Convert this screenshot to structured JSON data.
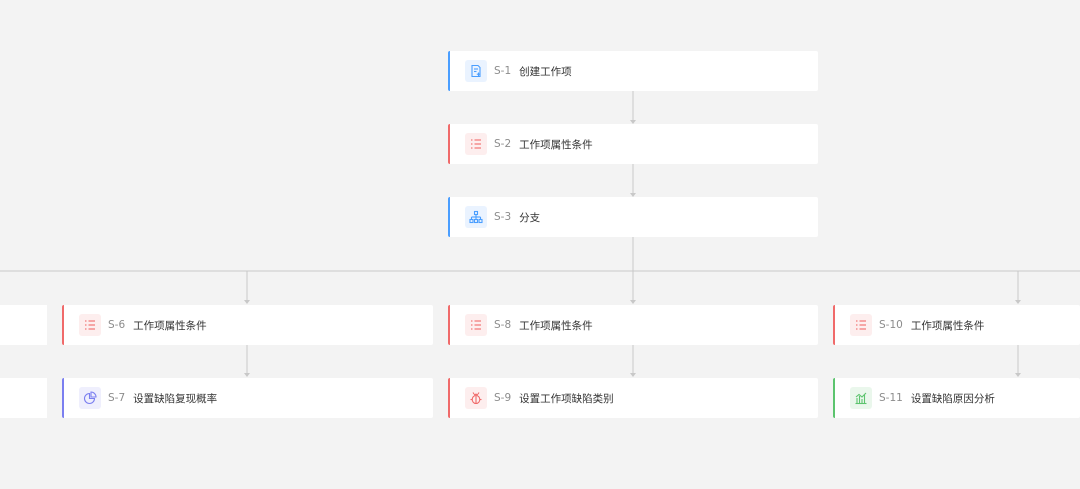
{
  "colors": {
    "blue": "#4a9eff",
    "red": "#f06a6a",
    "purple": "#7b7ff0",
    "green": "#5cc46e",
    "connector": "#c8c8c8"
  },
  "nodes": [
    {
      "id": "S-1",
      "code": "S-1",
      "label": "创建工作项",
      "icon": "document-add-icon",
      "color": "blue"
    },
    {
      "id": "S-2",
      "code": "S-2",
      "label": "工作项属性条件",
      "icon": "list-icon",
      "color": "red"
    },
    {
      "id": "S-3",
      "code": "S-3",
      "label": "分支",
      "icon": "hierarchy-icon",
      "color": "blue"
    },
    {
      "id": "S-6",
      "code": "S-6",
      "label": "工作项属性条件",
      "icon": "list-icon",
      "color": "red"
    },
    {
      "id": "S-7",
      "code": "S-7",
      "label": "设置缺陷复现概率",
      "icon": "pie-chart-icon",
      "color": "purple"
    },
    {
      "id": "S-8",
      "code": "S-8",
      "label": "工作项属性条件",
      "icon": "list-icon",
      "color": "red"
    },
    {
      "id": "S-9",
      "code": "S-9",
      "label": "设置工作项缺陷类别",
      "icon": "bug-icon",
      "color": "red"
    },
    {
      "id": "S-10",
      "code": "S-10",
      "label": "工作项属性条件",
      "icon": "list-icon",
      "color": "red"
    },
    {
      "id": "S-11",
      "code": "S-11",
      "label": "设置缺陷原因分析",
      "icon": "bar-chart-icon",
      "color": "green"
    }
  ]
}
